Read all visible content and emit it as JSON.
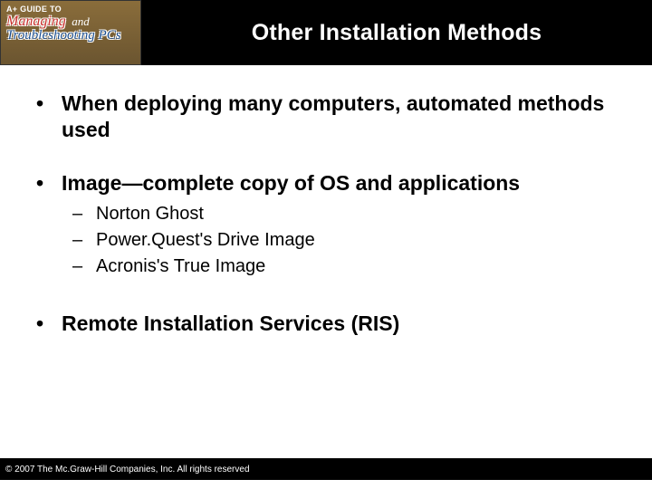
{
  "logo": {
    "topline": "A+ GUIDE TO",
    "line1_a": "Managing",
    "line1_b": "and",
    "line2": "Troubleshooting PCs"
  },
  "title": "Other Installation Methods",
  "bullets": {
    "b1": "When deploying many computers, automated methods used",
    "b2": "Image—complete copy of OS and applications",
    "b3": "Remote Installation Services (RIS)"
  },
  "subs": {
    "s1": "Norton Ghost",
    "s2": "Power.Quest's Drive Image",
    "s3": "Acronis's True Image"
  },
  "footer": "© 2007 The Mc.Graw-Hill Companies, Inc. All rights reserved"
}
